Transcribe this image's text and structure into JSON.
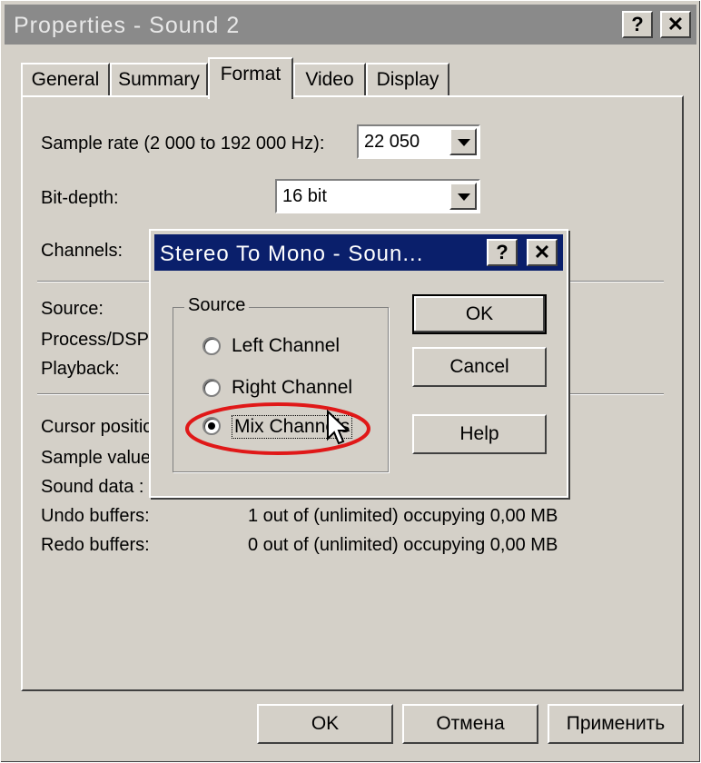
{
  "window": {
    "title": "Properties - Sound 2",
    "help_btn": "?",
    "close_btn": "✕"
  },
  "tabs": [
    {
      "label": "General"
    },
    {
      "label": "Summary"
    },
    {
      "label": "Format"
    },
    {
      "label": "Video"
    },
    {
      "label": "Display"
    }
  ],
  "format": {
    "sample_rate_label": "Sample rate (2 000 to 192 000 Hz):",
    "sample_rate_value": "22 050",
    "bit_depth_label": "Bit-depth:",
    "bit_depth_value": "16 bit",
    "channels_label": "Channels:"
  },
  "info": {
    "source_label": "Source:",
    "process_label": "Process/DSP",
    "playback_label": "Playback:",
    "cursor_label": "Cursor position",
    "sample_value_label": "Sample value",
    "sound_data_label": "Sound data :",
    "undo_label": "Undo buffers:",
    "undo_value": "1 out of (unlimited) occupying 0,00 MB",
    "redo_label": "Redo buffers:",
    "redo_value": "0 out of (unlimited) occupying 0,00 MB"
  },
  "footer": {
    "ok": "OK",
    "cancel": "Отмена",
    "apply": "Применить"
  },
  "dialog": {
    "title": "Stereo To Mono - Soun...",
    "help_btn": "?",
    "close_btn": "✕",
    "group_title": "Source",
    "options": [
      {
        "label": "Left Channel",
        "selected": false
      },
      {
        "label": "Right Channel",
        "selected": false
      },
      {
        "label": "Mix Channels",
        "selected": true
      }
    ],
    "ok": "OK",
    "cancel": "Cancel",
    "help": "Help"
  }
}
